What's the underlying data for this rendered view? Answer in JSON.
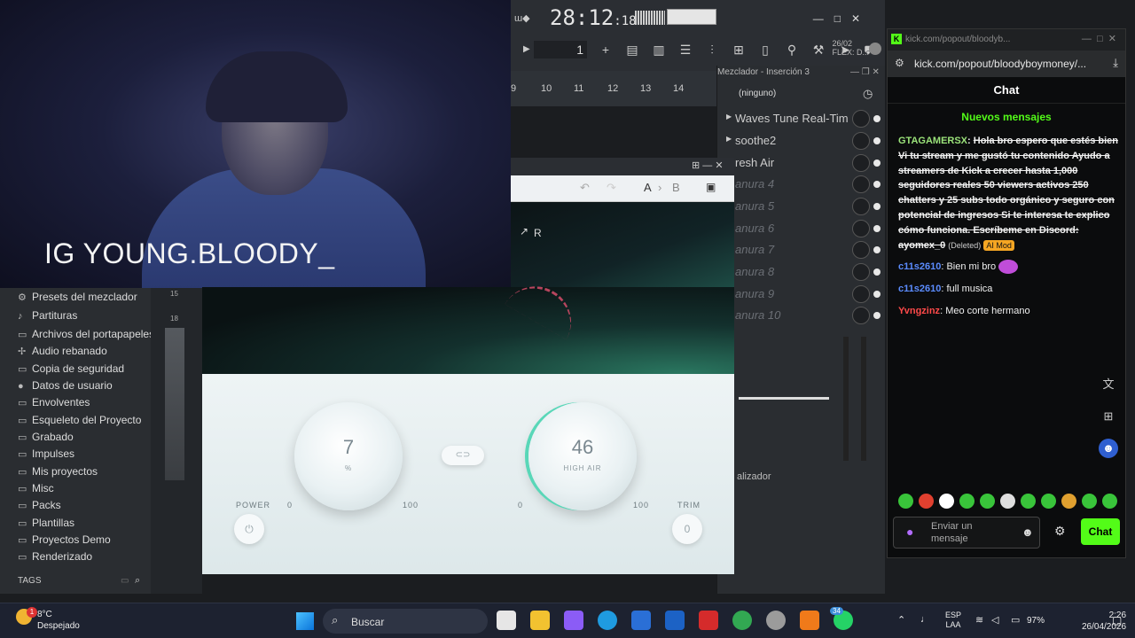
{
  "webcam": {
    "overlay_text": "IG YOUNG.BLOODY_"
  },
  "fl_toolbar": {
    "time_main": "28:12",
    "time_sub": "18",
    "pattern_number": "1",
    "date_line1": "26/02",
    "date_line2": "FLEX: D..."
  },
  "timeline": {
    "bars": [
      "9",
      "10",
      "11",
      "12",
      "13",
      "14"
    ]
  },
  "mixer": {
    "title": "Mezclador - Inserción 3",
    "preset": "(ninguno)",
    "slots": [
      {
        "name": "Waves Tune Real-Time S...",
        "active": true
      },
      {
        "name": "soothe2",
        "active": true
      },
      {
        "name": "resh Air",
        "active": true
      },
      {
        "name": "anura 4",
        "active": false
      },
      {
        "name": "anura 5",
        "active": false
      },
      {
        "name": "anura 6",
        "active": false
      },
      {
        "name": "anura 7",
        "active": false
      },
      {
        "name": "anura 8",
        "active": false
      },
      {
        "name": "anura 9",
        "active": false
      },
      {
        "name": "anura 10",
        "active": false
      }
    ],
    "eq_label": "alizador"
  },
  "plugin": {
    "a_label": "A",
    "b_label": "B",
    "r_label": "R",
    "power_label": "POWER",
    "trim_label": "TRIM",
    "trim_value": "0",
    "mid_air": {
      "value": "7",
      "unit": "%",
      "min": "0",
      "max": "100"
    },
    "high_air": {
      "value": "46",
      "label": "HIGH AIR",
      "min": "0",
      "max": "100"
    },
    "accent_color": "#59d7b8"
  },
  "browser": {
    "items": [
      {
        "icon": "mixer-presets-icon",
        "label": "Presets del mezclador"
      },
      {
        "icon": "note-icon",
        "label": "Partituras"
      },
      {
        "icon": "folder-icon",
        "label": "Archivos del portapapeles"
      },
      {
        "icon": "sliced-audio-icon",
        "label": "Audio rebanado"
      },
      {
        "icon": "backup-folder-icon",
        "label": "Copia de seguridad"
      },
      {
        "icon": "user-icon",
        "label": "Datos de usuario"
      },
      {
        "icon": "envelope-icon",
        "label": "Envolventes"
      },
      {
        "icon": "skeleton-icon",
        "label": "Esqueleto del Proyecto"
      },
      {
        "icon": "folder-icon",
        "label": "Grabado"
      },
      {
        "icon": "folder-icon",
        "label": "Impulses"
      },
      {
        "icon": "folder-icon",
        "label": "Mis proyectos"
      },
      {
        "icon": "folder-icon",
        "label": "Misc"
      },
      {
        "icon": "folder-icon",
        "label": "Packs"
      },
      {
        "icon": "folder-icon",
        "label": "Plantillas"
      },
      {
        "icon": "folder-icon",
        "label": "Proyectos Demo"
      },
      {
        "icon": "folder-icon",
        "label": "Renderizado"
      }
    ],
    "tags_label": "TAGS",
    "meter_numbers": [
      "15",
      "18"
    ]
  },
  "chat": {
    "tab_title": "kick.com/popout/bloodyb...",
    "url": "kick.com/popout/bloodyboymoney/...",
    "header": "Chat",
    "new_messages": "Nuevos mensajes",
    "messages": [
      {
        "user": "GTAGAMERSX",
        "color": "#9be37a",
        "text": "Hola bro espero que estés bien Vi tu stream y me gustó tu contenido Ayudo a streamers de Kick a crecer hasta 1,000 seguidores reales 50 viewers activos 250 chatters y 25 subs todo orgánico y seguro con potencial de ingresos Si te interesa te explico cómo funciona. Escríbeme en Discord: ayomex_0",
        "deleted_label": "(Deleted)",
        "badge": "AI Mod"
      },
      {
        "user": "c11s2610",
        "color": "#5b8cff",
        "text": "Bien mi bro"
      },
      {
        "user": "c11s2610",
        "color": "#5b8cff",
        "text": "full musica"
      },
      {
        "user": "Yvngzinz",
        "color": "#ff4a4a",
        "text": "Meo corte hermano"
      }
    ],
    "input_placeholder": "Enviar un mensaje",
    "send_label": "Chat",
    "brand_color": "#53fc18"
  },
  "taskbar": {
    "weather_temp": "8°C",
    "weather_desc": "Despejado",
    "weather_badge": "1",
    "search_placeholder": "Buscar",
    "lang_line1": "ESP",
    "lang_line2": "LAA",
    "battery": "97%",
    "time": "2:26",
    "date": "26/04/2026",
    "whatsapp_badge": "34"
  }
}
